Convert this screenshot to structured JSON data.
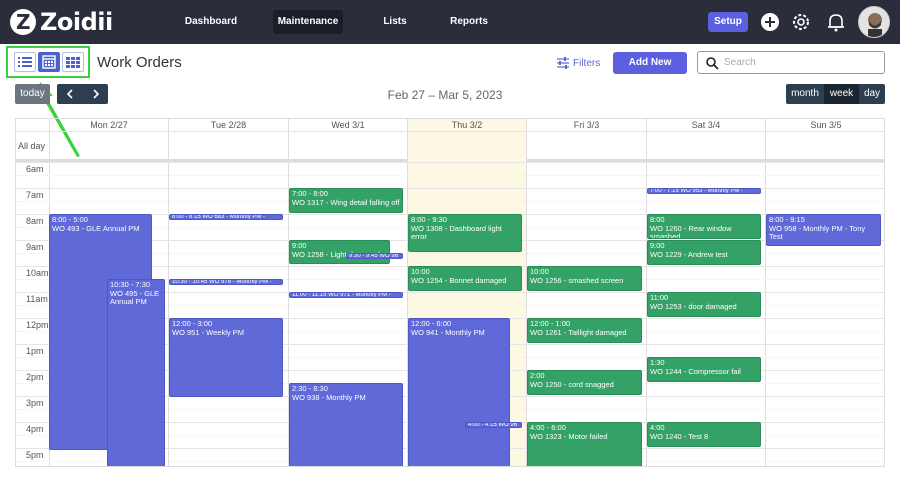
{
  "app": {
    "logo_text": "Zoidii"
  },
  "nav": {
    "items": [
      {
        "label": "Dashboard",
        "active": false
      },
      {
        "label": "Maintenance",
        "active": true
      },
      {
        "label": "Lists",
        "active": false
      },
      {
        "label": "Reports",
        "active": false
      }
    ],
    "setup_label": "Setup"
  },
  "page": {
    "title": "Work Orders",
    "filters_label": "Filters",
    "add_new_label": "Add New",
    "search_placeholder": "Search"
  },
  "calendar": {
    "today_label": "today",
    "range": "Feb 27 – Mar 5, 2023",
    "views": [
      "month",
      "week",
      "day"
    ],
    "active_view": "week",
    "allday_label": "All day",
    "days": [
      "Mon 2/27",
      "Tue 2/28",
      "Wed 3/1",
      "Thu 3/2",
      "Fri 3/3",
      "Sat 3/4",
      "Sun 3/5"
    ],
    "hours": [
      "6am",
      "7am",
      "8am",
      "9am",
      "10am",
      "11am",
      "12pm",
      "1pm",
      "2pm",
      "3pm",
      "4pm",
      "5pm"
    ],
    "events": [
      {
        "time": "8:00 - 5:00",
        "title": "WO 493 - GLE Annual PM",
        "color": "blue"
      },
      {
        "time": "10:30 - 7:30",
        "title": "WO 495 - GLE Annual PM",
        "color": "blue"
      },
      {
        "time": "8:00 - 8:15",
        "title": "WO 683 - Monthly PM -",
        "color": "blue"
      },
      {
        "time": "10:30 - 10:45",
        "title": "WO 978 - Monthly PM -",
        "color": "blue"
      },
      {
        "time": "12:00 - 3:00",
        "title": "WO 951 - Weekly PM",
        "color": "blue"
      },
      {
        "time": "7:00 - 8:00",
        "title": "WO 1317 - Wing detail falling off",
        "color": "green"
      },
      {
        "time": "9:00",
        "title": "WO 1258 - Light damaged",
        "color": "green"
      },
      {
        "time": "9:30 - 9:45",
        "title": "WO 96",
        "color": "blue"
      },
      {
        "time": "11:00 - 11:15",
        "title": "WO 971 - Monthly PM -",
        "color": "blue"
      },
      {
        "time": "2:30 - 8:30",
        "title": "WO 938 - Monthly PM",
        "color": "blue"
      },
      {
        "time": "8:00 - 9:30",
        "title": "WO 1308 - Dashboard light error",
        "color": "green"
      },
      {
        "time": "10:00",
        "title": "WO 1254 - Bonnet damaged",
        "color": "green"
      },
      {
        "time": "12:00 - 6:00",
        "title": "WO 941 - Monthly PM",
        "color": "blue"
      },
      {
        "time": "4:00 - 4:15",
        "title": "WO 96",
        "color": "blue"
      },
      {
        "time": "10:00",
        "title": "WO 1256 - smashed screen",
        "color": "green"
      },
      {
        "time": "12:00 - 1:00",
        "title": "WO 1261 - Taillight damaged",
        "color": "green"
      },
      {
        "time": "2:00",
        "title": "WO 1250 - cord snagged",
        "color": "green"
      },
      {
        "time": "4:00 - 6:00",
        "title": "WO 1323 - Motor failed",
        "color": "green"
      },
      {
        "time": "7:00 - 7:15",
        "title": "WO 953 - Monthly PM -",
        "color": "blue"
      },
      {
        "time": "8:00",
        "title": "WO 1260 - Rear window smashed",
        "color": "green"
      },
      {
        "time": "9:00",
        "title": "WO 1229 - Andrew test",
        "color": "green"
      },
      {
        "time": "11:00",
        "title": "WO 1253 - door damaged",
        "color": "green"
      },
      {
        "time": "1:30",
        "title": "WO 1244 - Compressor fail",
        "color": "green"
      },
      {
        "time": "4:00",
        "title": "WO 1240 - Test 8",
        "color": "green"
      },
      {
        "time": "8:00 - 9:15",
        "title": "WO 958 - Monthly PM - Tony Test",
        "color": "blue"
      }
    ]
  },
  "colors": {
    "nav_bg": "#2b2d3a",
    "accent": "#5b5fe0",
    "event_blue": "#5f6ad8",
    "event_green": "#34a267",
    "today_bg": "#fcf8e3",
    "highlight": "#3ad23a"
  }
}
